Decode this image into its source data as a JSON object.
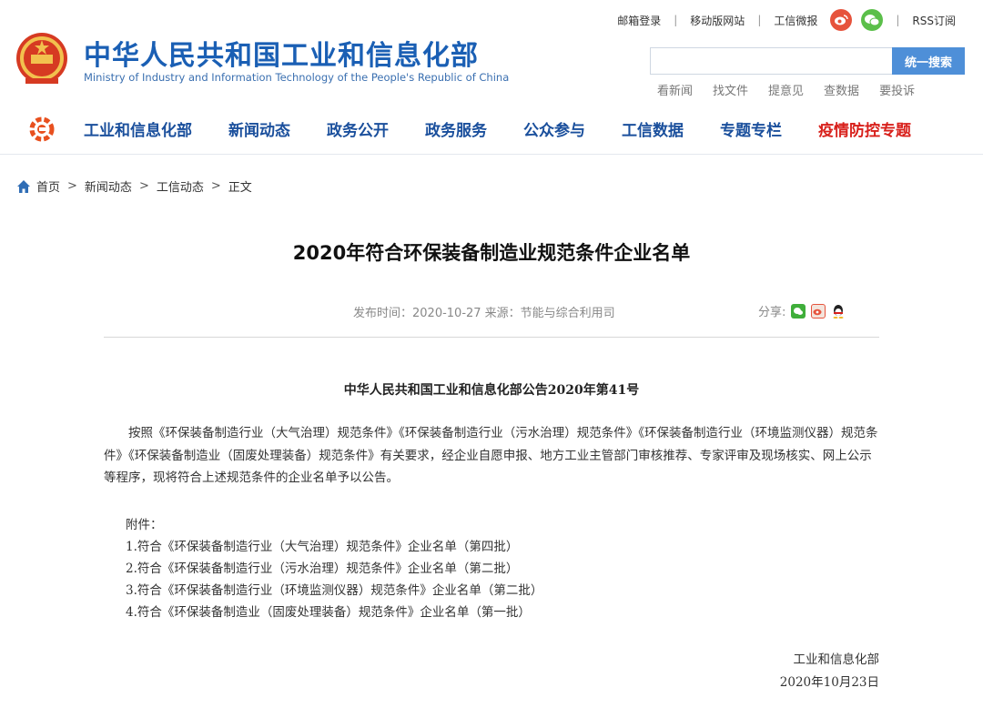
{
  "header": {
    "title": "中华人民共和国工业和信息化部",
    "subtitle": "Ministry of Industry and Information Technology of the People's Republic of China",
    "top_links": [
      "邮箱登录",
      "移动版网站",
      "工信微报",
      "RSS订阅"
    ],
    "search": {
      "placeholder": "",
      "button_label": "统一搜索"
    },
    "quick_links": [
      "看新闻",
      "找文件",
      "提意见",
      "查数据",
      "要投诉"
    ]
  },
  "nav": {
    "items": [
      "工业和信息化部",
      "新闻动态",
      "政务公开",
      "政务服务",
      "公众参与",
      "工信数据",
      "专题专栏",
      "疫情防控专题"
    ]
  },
  "breadcrumb": [
    "首页",
    "新闻动态",
    "工信动态",
    "正文"
  ],
  "article": {
    "title": "2020年符合环保装备制造业规范条件企业名单",
    "meta": "发布时间：2020-10-27  来源：节能与综合利用司",
    "share_label": "分享:",
    "notice_title": "中华人民共和国工业和信息化部公告2020年第41号",
    "body": "按照《环保装备制造行业（大气治理）规范条件》《环保装备制造行业（污水治理）规范条件》《环保装备制造行业（环境监测仪器）规范条件》《环保装备制造业（固废处理装备）规范条件》有关要求，经企业自愿申报、地方工业主管部门审核推荐、专家评审及现场核实、网上公示等程序，现将符合上述规范条件的企业名单予以公告。",
    "attachment_label": "附件：",
    "attachments": [
      "1.符合《环保装备制造行业（大气治理）规范条件》企业名单（第四批）",
      "2.符合《环保装备制造行业（污水治理）规范条件》企业名单（第二批）",
      "3.符合《环保装备制造行业（环境监测仪器）规范条件》企业名单（第二批）",
      "4.符合《环保装备制造业（固废处理装备）规范条件》企业名单（第一批）"
    ],
    "signature": "工业和信息化部",
    "date": "2020年10月23日"
  },
  "colors": {
    "brand_blue": "#1a5fb4",
    "nav_blue": "#1a4f9c",
    "highlight_red": "#d8201b",
    "search_button": "#4e8fd8"
  }
}
